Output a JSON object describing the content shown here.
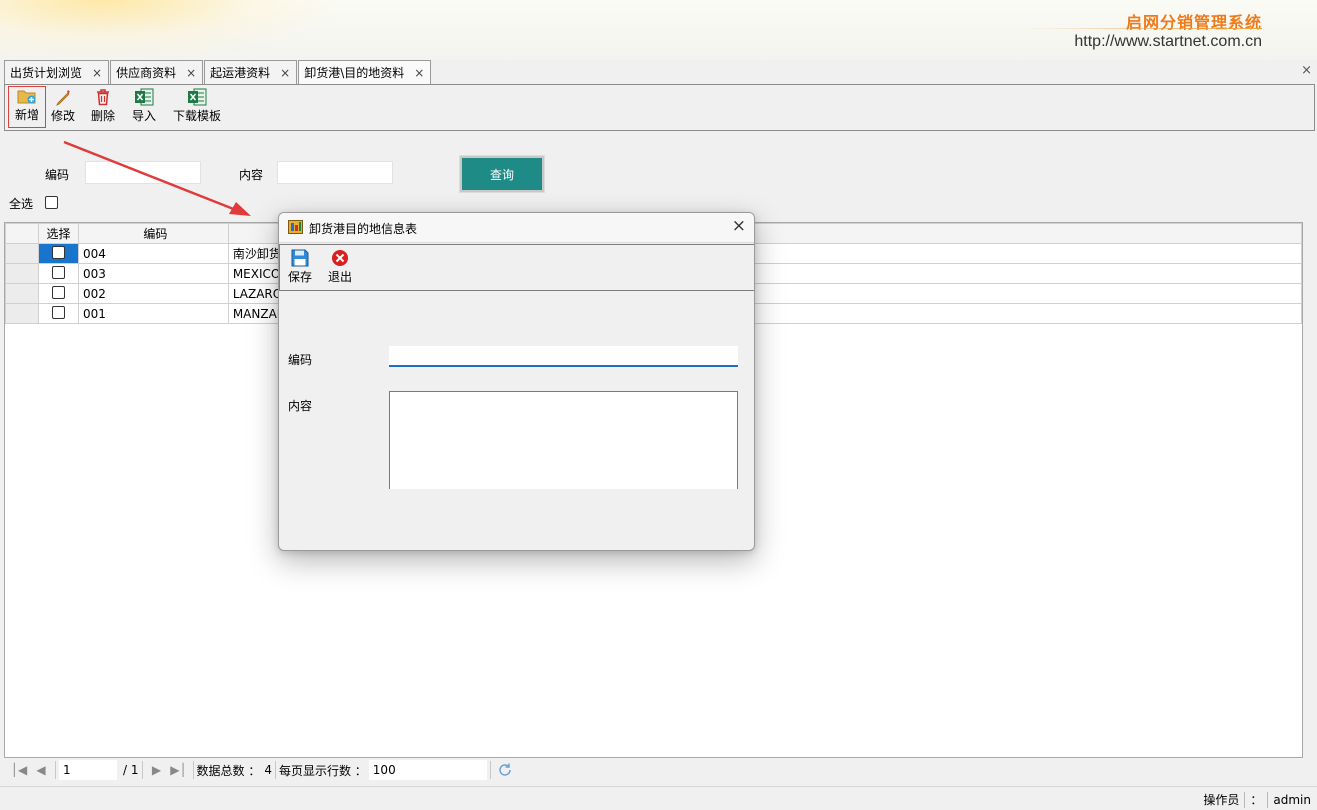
{
  "header": {
    "system_name": "启网分销管理系统",
    "url": "http://www.startnet.com.cn"
  },
  "tabs": [
    {
      "label": "出货计划浏览",
      "close": "×"
    },
    {
      "label": "供应商资料",
      "close": "×"
    },
    {
      "label": "起运港资料",
      "close": "×"
    },
    {
      "label": "卸货港\\目的地资料",
      "close": "×",
      "active": true
    }
  ],
  "tabs_close": "×",
  "toolbar": {
    "add": "新增",
    "edit": "修改",
    "delete": "删除",
    "import": "导入",
    "download_template": "下载模板"
  },
  "filters": {
    "code_label": "编码",
    "code_value": "",
    "content_label": "内容",
    "content_value": "",
    "query_button": "查询",
    "select_all_label": "全选"
  },
  "grid": {
    "headers": {
      "select": "选择",
      "code": "编码",
      "content": ""
    },
    "rows": [
      {
        "code": "004",
        "content": "南沙卸货",
        "selected": true
      },
      {
        "code": "003",
        "content": "MEXICO",
        "selected": false
      },
      {
        "code": "002",
        "content": "LAZARO",
        "selected": false
      },
      {
        "code": "001",
        "content": "MANZAN",
        "selected": false
      }
    ]
  },
  "pager": {
    "current_page": "1",
    "total_pages": "/ 1",
    "total_label": "数据总数 ：",
    "total_count": "4",
    "page_size_label": "每页显示行数 ：",
    "page_size": "100"
  },
  "status": {
    "operator_label": "操作员",
    "colon": "：",
    "operator": "admin"
  },
  "dialog": {
    "title": "卸货港目的地信息表",
    "close": "×",
    "save": "保存",
    "exit": "退出",
    "code_label": "编码",
    "code_value": "",
    "content_label": "内容",
    "content_value": ""
  },
  "colors": {
    "brand_orange": "#f07a18",
    "query_button": "#1f8b87",
    "selection_blue": "#1874cd",
    "annotation_arrow": "#e03a3a"
  }
}
